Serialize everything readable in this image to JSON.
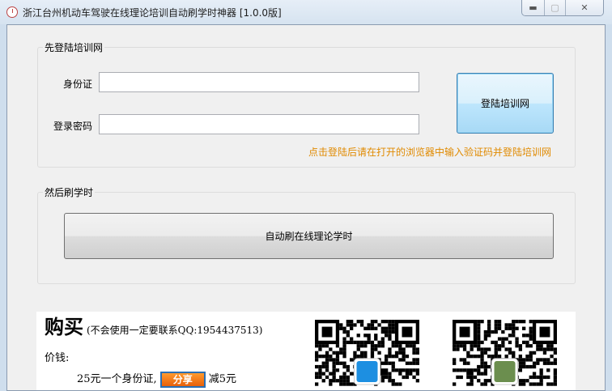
{
  "window": {
    "title": "浙江台州机动车驾驶在线理论培训自动刷学时神器 [1.0.0版]",
    "min": "▭",
    "max": "▫",
    "close": "✕"
  },
  "login": {
    "group_label": "先登陆培训网",
    "id_label": "身份证",
    "id_value": "",
    "password_label": "登录密码",
    "password_value": "",
    "login_button": "登陆培训网",
    "hint": "点击登陆后请在打开的浏览器中输入验证码并登陆培训网"
  },
  "study": {
    "group_label": "然后刷学时",
    "start_button": "自动刷在线理论学时"
  },
  "purchase": {
    "title": "购买",
    "note": "(不会使用一定要联系QQ:1954437513)",
    "price_label": "价钱:",
    "price_text": "25元一个身份证,",
    "share_button": "分享",
    "discount": "减5元"
  }
}
